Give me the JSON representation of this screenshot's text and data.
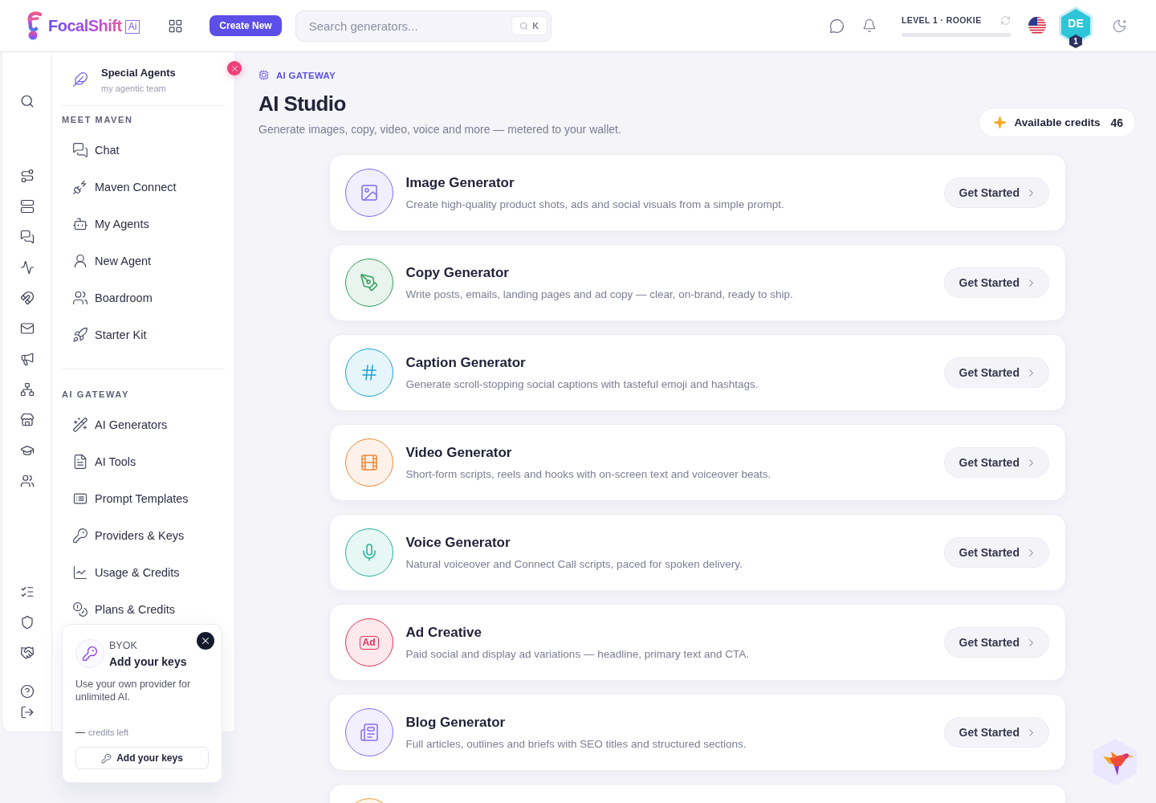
{
  "topbar": {
    "logo": {
      "name": "FocalShift",
      "suffix": "Ai"
    },
    "create_button": "Create New",
    "search": {
      "placeholder": "Search generators...",
      "shortcut": "K"
    },
    "progress": {
      "label": "LEVEL 1 · ROOKIE"
    },
    "avatar": {
      "initials": "DE",
      "badge": "1"
    }
  },
  "sidebar": {
    "header": {
      "title": "Special Agents",
      "subtitle": "my agentic team"
    },
    "sections": [
      {
        "label": "MEET MAVEN",
        "items": [
          {
            "label": "Chat",
            "selected": false
          },
          {
            "label": "Maven Connect",
            "selected": false
          },
          {
            "label": "My Agents",
            "selected": false
          },
          {
            "label": "New Agent",
            "selected": false
          },
          {
            "label": "Boardroom",
            "selected": false
          },
          {
            "label": "Starter Kit",
            "selected": false
          }
        ]
      },
      {
        "label": "AI GATEWAY",
        "items": [
          {
            "label": "AI Generators",
            "selected": false
          },
          {
            "label": "AI Tools",
            "selected": false
          },
          {
            "label": "Prompt Templates",
            "selected": false
          },
          {
            "label": "Providers & Keys",
            "selected": false
          },
          {
            "label": "Usage & Credits",
            "selected": false
          },
          {
            "label": "Plans & Credits",
            "selected": false
          }
        ]
      }
    ]
  },
  "byok_card": {
    "eyebrow": "BYOK",
    "title": "Add your keys",
    "text": "Use your own provider for unlimited AI.",
    "credits_value": "—",
    "credits_label": "credits left",
    "button": "Add your keys"
  },
  "main": {
    "eyebrow": "AI GATEWAY",
    "title": "AI Studio",
    "subtitle": "Generate images, copy, video, voice and more — metered to your wallet.",
    "credits": {
      "label": "Available credits",
      "value": "46"
    },
    "cards": [
      {
        "title": "Image Generator",
        "description": "Create high-quality product shots, ads and social visuals from a simple prompt.",
        "button": "Get Started",
        "color": "#7c6cf0"
      },
      {
        "title": "Copy Generator",
        "description": "Write posts, emails, landing pages and ad copy — clear, on-brand, ready to ship.",
        "button": "Get Started",
        "color": "#2e9e5b"
      },
      {
        "title": "Caption Generator",
        "description": "Generate scroll-stopping social captions with tasteful emoji and hashtags.",
        "button": "Get Started",
        "color": "#1aa3d4"
      },
      {
        "title": "Video Generator",
        "description": "Short-form scripts, reels and hooks with on-screen text and voiceover beats.",
        "button": "Get Started",
        "color": "#f0883a"
      },
      {
        "title": "Voice Generator",
        "description": "Natural voiceover and Connect Call scripts, paced for spoken delivery.",
        "button": "Get Started",
        "color": "#22b29a"
      },
      {
        "title": "Ad Creative",
        "icon_text": "Ad",
        "description": "Paid social and display ad variations — headline, primary text and CTA.",
        "button": "Get Started",
        "color": "#e0325a"
      },
      {
        "title": "Blog Generator",
        "description": "Full articles, outlines and briefs with SEO titles and structured sections.",
        "button": "Get Started",
        "color": "#8b6cf2"
      },
      {
        "color": "#e9a13b"
      }
    ]
  }
}
